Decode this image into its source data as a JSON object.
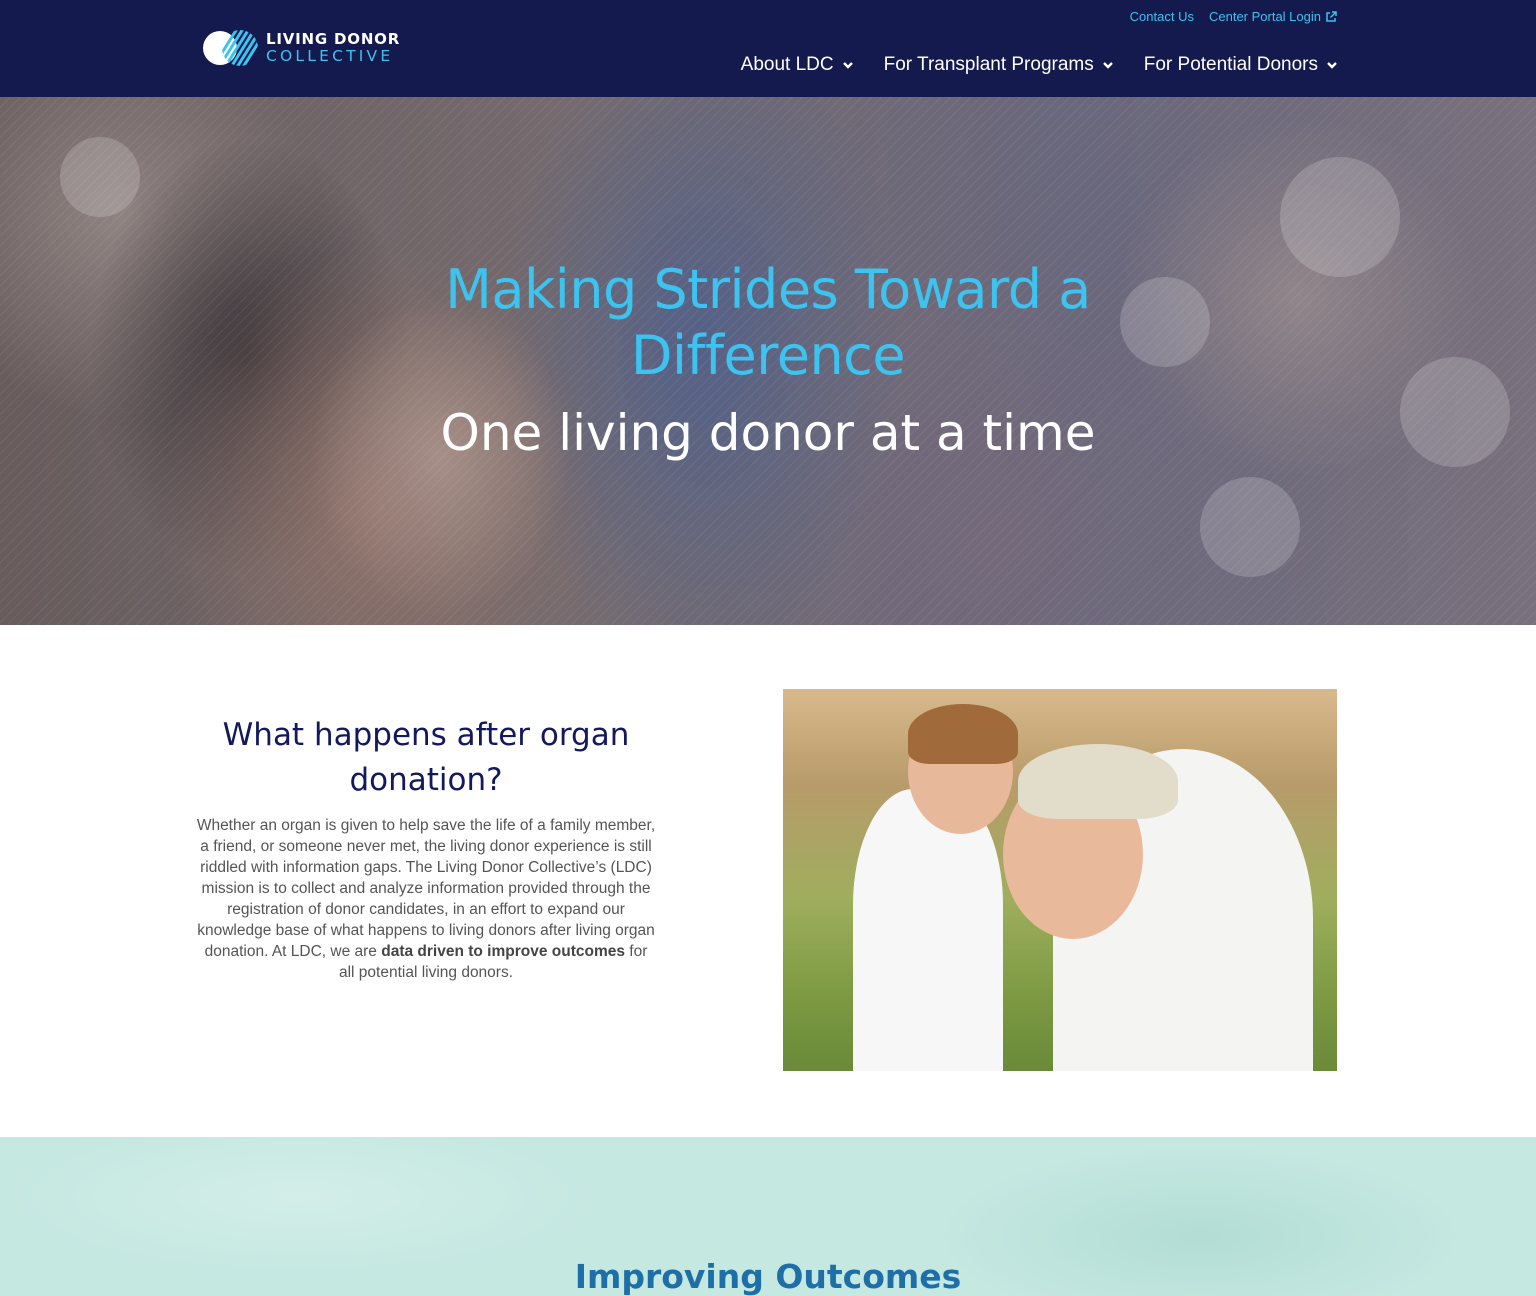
{
  "header": {
    "logo": {
      "line1": "LIVING DONOR",
      "line2": "COLLECTIVE",
      "mark_colors": [
        "#ffffff",
        "#3cc3ef"
      ]
    },
    "utility_links": [
      {
        "label": "Contact Us"
      },
      {
        "label": "Center Portal Login",
        "icon": "external-link-icon"
      }
    ],
    "nav": [
      {
        "label": "About LDC",
        "icon": "chevron-down-icon"
      },
      {
        "label": "For Transplant Programs",
        "icon": "chevron-down-icon"
      },
      {
        "label": "For Potential Donors",
        "icon": "chevron-down-icon"
      }
    ]
  },
  "hero": {
    "title": "Making Strides Toward a Difference",
    "subtitle": "One living donor at a time"
  },
  "intro": {
    "heading": "What happens after organ donation?",
    "body_before": "Whether an organ is given to help save the life of a family member, a friend, or someone never met, the living donor experience is still riddled with information gaps. The Living Donor Collective’s (LDC) mission is to collect and analyze information provided through the registration of donor candidates, in an effort to expand our knowledge base of what happens to living donors after living organ donation. At LDC, we are ",
    "body_bold": "data driven to improve outcomes",
    "body_after": " for all potential living donors."
  },
  "outcomes": {
    "title": "Improving Outcomes"
  },
  "colors": {
    "header_bg": "#14194e",
    "accent": "#3cc3ef",
    "heading": "#14195e",
    "outcomes_bg": "#c5e8e1",
    "outcomes_title": "#1e6ea8"
  }
}
